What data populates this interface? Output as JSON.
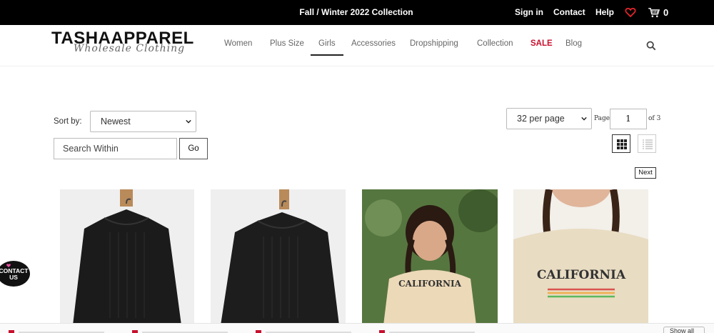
{
  "topbar": {
    "promo": "Fall / Winter 2022 Collection",
    "signin": "Sign in",
    "contact": "Contact",
    "help": "Help",
    "cart_count": "0",
    "icons": [
      "heart-icon",
      "cart-icon"
    ],
    "accent": "#e3262b"
  },
  "header": {
    "logo": "TASHAAPPAREL",
    "logo_sub": "Wholesale Clothing",
    "nav": [
      "Women",
      "Plus Size",
      "Girls",
      "Accessories",
      "Dropshipping",
      "Collection",
      "SALE",
      "Blog"
    ],
    "active_nav": "Girls",
    "sale_color": "#c8102e"
  },
  "toolbar": {
    "sort_label": "Sort by:",
    "sort_value": "Newest",
    "search_placeholder": "Search Within",
    "go_label": "Go",
    "per_page": "32 per page",
    "page_label": "Page",
    "page_value": "1",
    "page_of": "of 3",
    "next_label": "Next"
  },
  "products": [
    {
      "alt": "black blouse on hanger"
    },
    {
      "alt": "black blouse on hanger"
    },
    {
      "alt": "girl wearing California tee"
    },
    {
      "alt": "girl wearing California tee close-up"
    }
  ],
  "contact_badge": "CONTACT US",
  "bottom_chip": "Show all"
}
